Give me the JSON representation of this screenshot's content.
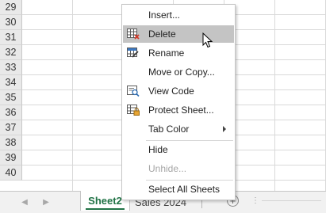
{
  "grid": {
    "rows": [
      "29",
      "30",
      "31",
      "32",
      "33",
      "34",
      "35",
      "36",
      "37",
      "38",
      "39",
      "40"
    ]
  },
  "tabs": {
    "active": "Sheet2",
    "other": "Sales 2024"
  },
  "context_menu": {
    "items": [
      {
        "label": "Insert...",
        "icon": null,
        "disabled": false
      },
      {
        "label": "Delete",
        "icon": "delete-sheet-icon",
        "disabled": false,
        "hover": true
      },
      {
        "label": "Rename",
        "icon": "rename-sheet-icon",
        "disabled": false
      },
      {
        "label": "Move or Copy...",
        "icon": null,
        "disabled": false
      },
      {
        "label": "View Code",
        "icon": "view-code-icon",
        "disabled": false
      },
      {
        "label": "Protect Sheet...",
        "icon": "protect-sheet-icon",
        "disabled": false
      },
      {
        "label": "Tab Color",
        "icon": null,
        "disabled": false,
        "submenu": true
      },
      {
        "label": "Hide",
        "icon": null,
        "disabled": false
      },
      {
        "label": "Unhide...",
        "icon": null,
        "disabled": true
      },
      {
        "label": "Select All Sheets",
        "icon": null,
        "disabled": false
      }
    ]
  },
  "colors": {
    "accent": "#217346",
    "hover": "#c4c4c4"
  }
}
